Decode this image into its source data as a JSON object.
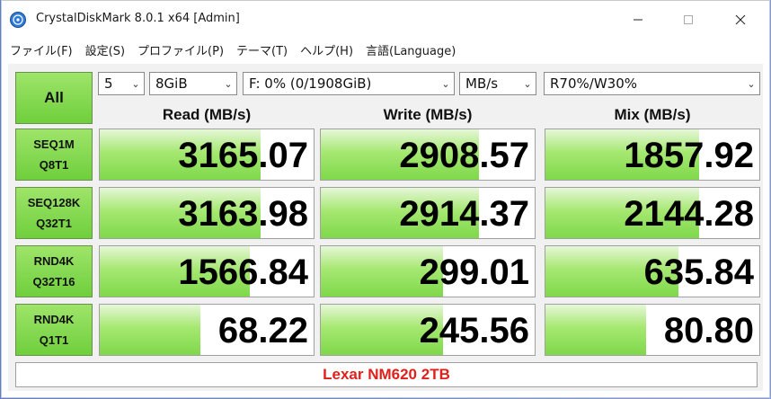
{
  "window": {
    "title": "CrystalDiskMark 8.0.1 x64 [Admin]"
  },
  "menu": [
    "ファイル(F)",
    "設定(S)",
    "プロファイル(P)",
    "テーマ(T)",
    "ヘルプ(H)",
    "言語(Language)"
  ],
  "controls": {
    "all_label": "All",
    "count": "5",
    "size": "8GiB",
    "drive": "F: 0% (0/1908GiB)",
    "unit": "MB/s",
    "mix": "R70%/W30%"
  },
  "headers": {
    "read": "Read (MB/s)",
    "write": "Write (MB/s)",
    "mix": "Mix (MB/s)"
  },
  "rows": [
    {
      "line1": "SEQ1M",
      "line2": "Q8T1",
      "read": "3165.07",
      "write": "2908.57",
      "mix": "1857.92",
      "read_fill": 0.75,
      "write_fill": 0.74,
      "mix_fill": 0.72
    },
    {
      "line1": "SEQ128K",
      "line2": "Q32T1",
      "read": "3163.98",
      "write": "2914.37",
      "mix": "2144.28",
      "read_fill": 0.75,
      "write_fill": 0.74,
      "mix_fill": 0.72
    },
    {
      "line1": "RND4K",
      "line2": "Q32T16",
      "read": "1566.84",
      "write": "299.01",
      "mix": "635.84",
      "read_fill": 0.7,
      "write_fill": 0.57,
      "mix_fill": 0.62
    },
    {
      "line1": "RND4K",
      "line2": "Q1T1",
      "read": "68.22",
      "write": "245.56",
      "mix": "80.80",
      "read_fill": 0.47,
      "write_fill": 0.57,
      "mix_fill": 0.47
    }
  ],
  "comment": "Lexar NM620 2TB",
  "colors": {
    "accent_green": "#7fd84a",
    "comment_red": "#e0201b"
  }
}
